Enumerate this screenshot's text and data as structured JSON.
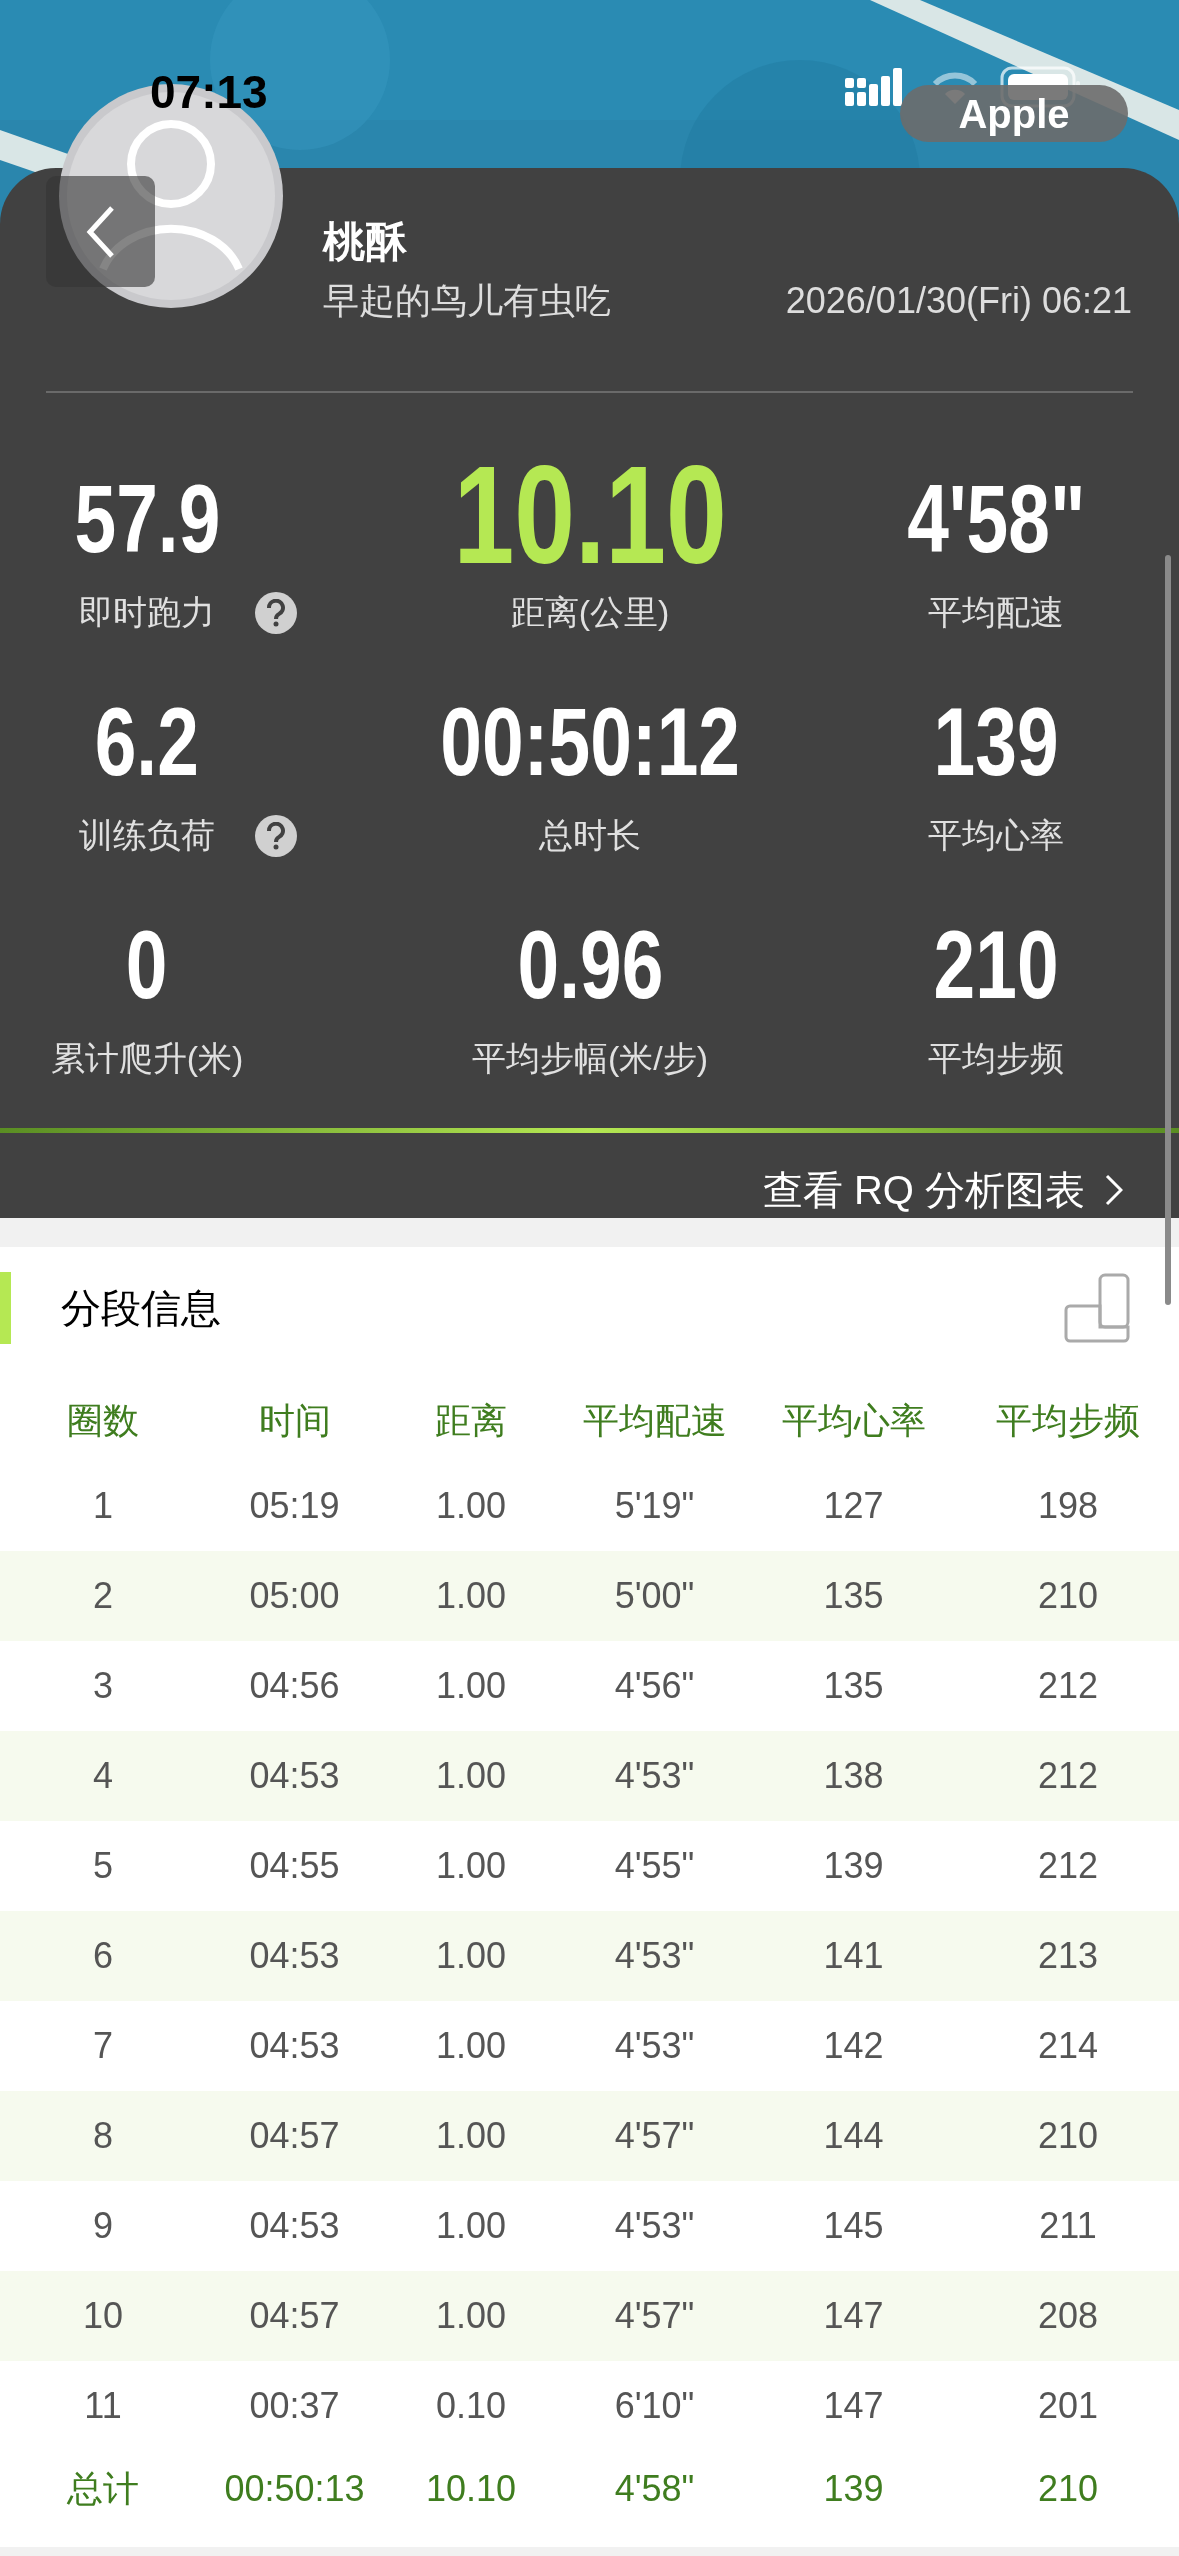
{
  "status_bar": {
    "time": "07:13"
  },
  "overlay_pill": {
    "label": "Apple"
  },
  "profile": {
    "name": "桃酥",
    "motto": "早起的鸟儿有虫吃",
    "datetime": "2026/01/30(Fri) 06:21"
  },
  "stats": [
    {
      "value": "57.9",
      "label": "即时跑力",
      "help": true,
      "highlight": false
    },
    {
      "value": "10.10",
      "label": "距离(公里)",
      "help": false,
      "highlight": true
    },
    {
      "value": "4'58\"",
      "label": "平均配速",
      "help": false,
      "highlight": false
    },
    {
      "value": "6.2",
      "label": "训练负荷",
      "help": true,
      "highlight": false
    },
    {
      "value": "00:50:12",
      "label": "总时长",
      "help": false,
      "highlight": false
    },
    {
      "value": "139",
      "label": "平均心率",
      "help": false,
      "highlight": false
    },
    {
      "value": "0",
      "label": "累计爬升(米)",
      "help": false,
      "highlight": false
    },
    {
      "value": "0.96",
      "label": "平均步幅(米/步)",
      "help": false,
      "highlight": false
    },
    {
      "value": "210",
      "label": "平均步频",
      "help": false,
      "highlight": false
    }
  ],
  "rq_link": {
    "label": "查看 RQ 分析图表"
  },
  "laps": {
    "title": "分段信息",
    "columns": [
      "圈数",
      "时间",
      "距离",
      "平均配速",
      "平均心率",
      "平均步频"
    ],
    "rows": [
      [
        "1",
        "05:19",
        "1.00",
        "5'19\"",
        "127",
        "198"
      ],
      [
        "2",
        "05:00",
        "1.00",
        "5'00\"",
        "135",
        "210"
      ],
      [
        "3",
        "04:56",
        "1.00",
        "4'56\"",
        "135",
        "212"
      ],
      [
        "4",
        "04:53",
        "1.00",
        "4'53\"",
        "138",
        "212"
      ],
      [
        "5",
        "04:55",
        "1.00",
        "4'55\"",
        "139",
        "212"
      ],
      [
        "6",
        "04:53",
        "1.00",
        "4'53\"",
        "141",
        "213"
      ],
      [
        "7",
        "04:53",
        "1.00",
        "4'53\"",
        "142",
        "214"
      ],
      [
        "8",
        "04:57",
        "1.00",
        "4'57\"",
        "144",
        "210"
      ],
      [
        "9",
        "04:53",
        "1.00",
        "4'53\"",
        "145",
        "211"
      ],
      [
        "10",
        "04:57",
        "1.00",
        "4'57\"",
        "147",
        "208"
      ],
      [
        "11",
        "00:37",
        "0.10",
        "6'10\"",
        "147",
        "201"
      ]
    ],
    "total": [
      "总计",
      "00:50:13",
      "10.10",
      "4'58\"",
      "139",
      "210"
    ]
  }
}
